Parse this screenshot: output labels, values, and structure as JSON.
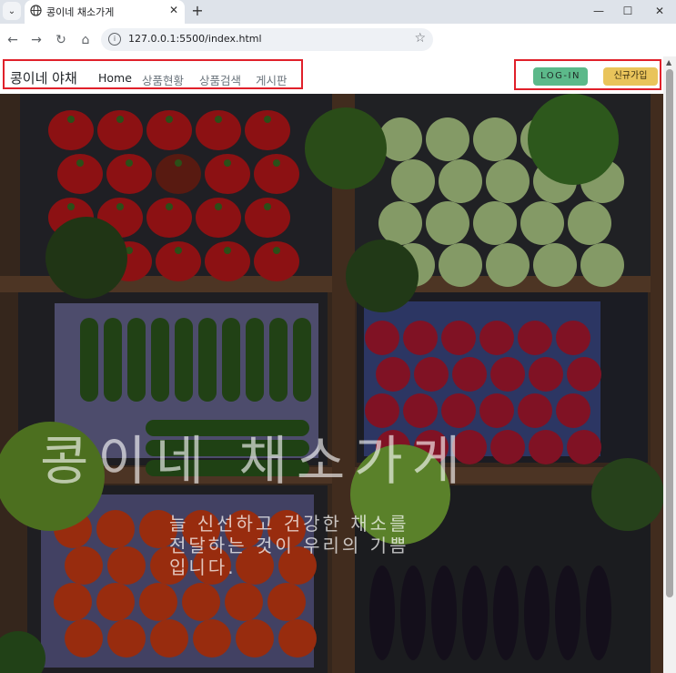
{
  "browser": {
    "tab_title": "콩이네 채소가게",
    "url": "127.0.0.1:5500/index.html",
    "new_tab_symbol": "+",
    "close_symbol": "✕",
    "minimize_symbol": "—",
    "maximize_symbol": "☐",
    "window_close_symbol": "✕",
    "back_symbol": "←",
    "forward_symbol": "→",
    "reload_symbol": "↻",
    "home_symbol": "⌂",
    "bookmark_symbol": "☆",
    "tab_menu_symbol": "⌄"
  },
  "site": {
    "brand": "콩이네 야채",
    "nav": [
      "Home",
      "상품현황",
      "상품검색",
      "게시판"
    ],
    "login_label": "LOG-IN",
    "signup_label": "신규가입",
    "login_color": "#5cb98a",
    "signup_color": "#e9c45b",
    "highlight_color": "#e0202a"
  },
  "hero": {
    "title": "콩이네 채소가게",
    "subtitle_lines": [
      "늘 신선하고 건강한 채소를",
      "전달하는 것이 우리의 기쁨",
      "입니다."
    ]
  }
}
